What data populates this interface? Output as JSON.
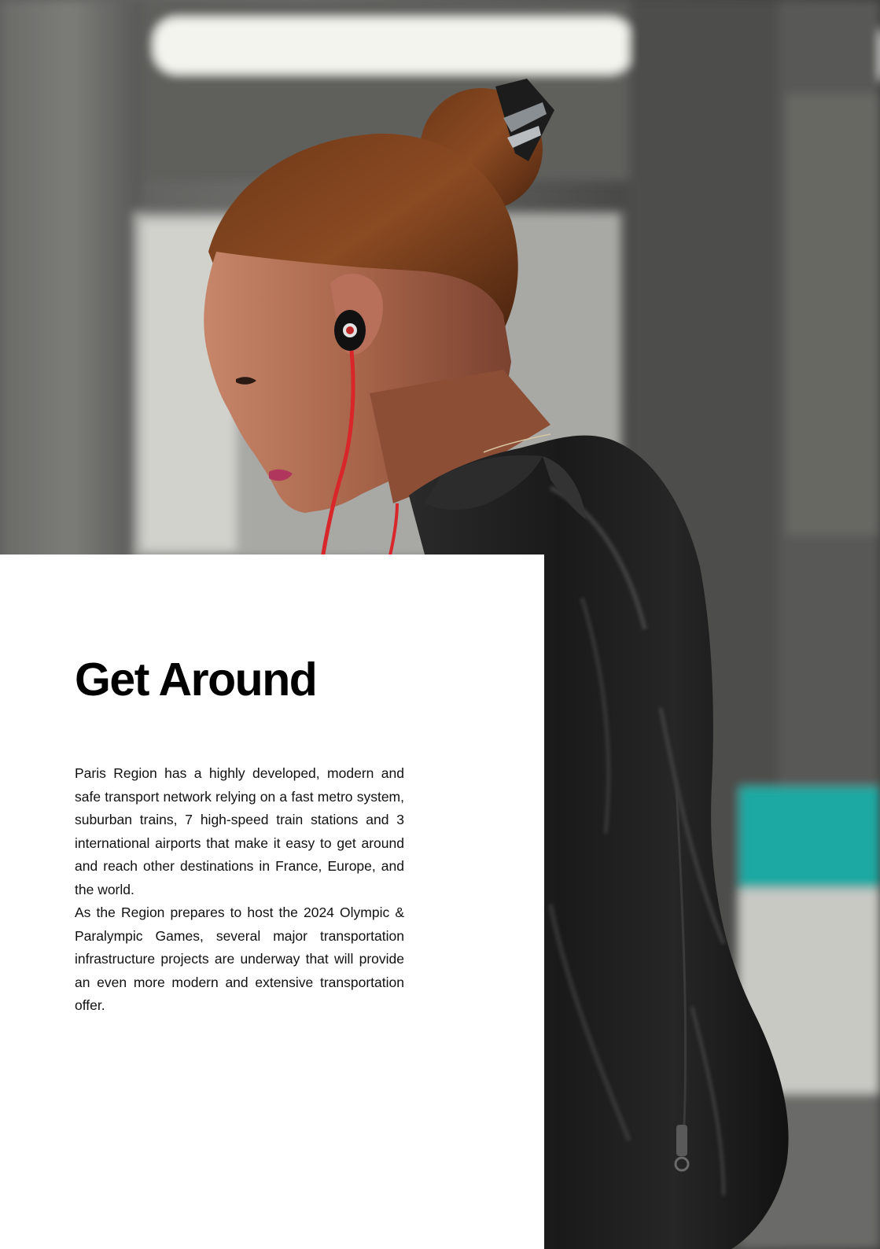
{
  "page": {
    "title": "Get Around",
    "paragraphs": [
      "Paris Region has a highly developed, modern and safe transport network relying on a fast metro system, suburban trains, 7 high-speed train stations and 3 international airports that make it easy to get around and reach other destinations in France, Europe, and the world.",
      "As the Region prepares to host the 2024 Olympic & Paralympic Games, several major transportation infrastructure projects are underway that will provide an even more modern and extensive transportation offer."
    ]
  },
  "colors": {
    "panel_background": "#ffffff",
    "title_color": "#000000",
    "text_color": "#111111",
    "accent_teal": "#1aa9a3",
    "earphone_cable": "#d8262b"
  }
}
